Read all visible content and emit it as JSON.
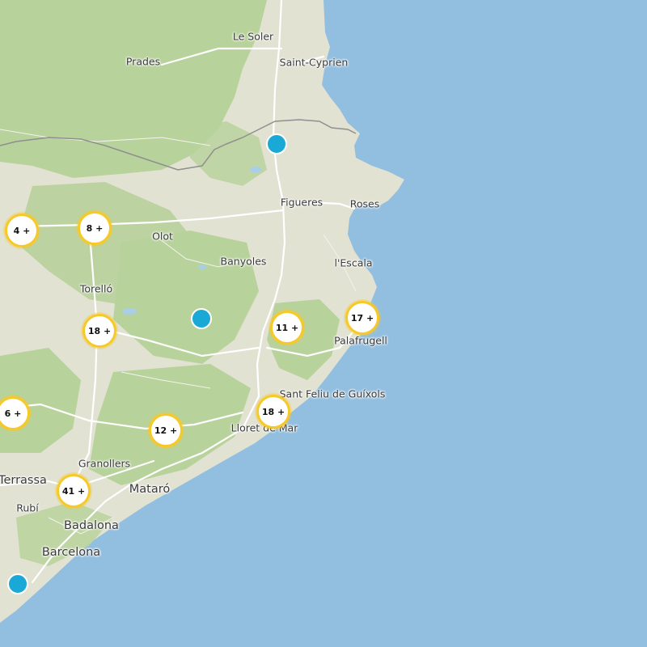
{
  "map": {
    "colors": {
      "sea": "#92bfe0",
      "land": "#e1e2d2",
      "forest": "#b8d29b",
      "road": "#ffffff",
      "border": "#8f8f8f",
      "cluster_ring": "#f7c928",
      "marker": "#1aa9d6"
    },
    "places": [
      {
        "id": "le-soler",
        "label": "Le Soler",
        "size": "town"
      },
      {
        "id": "prades",
        "label": "Prades",
        "size": "town"
      },
      {
        "id": "saint-cyprien",
        "label": "Saint-Cyprien",
        "size": "town"
      },
      {
        "id": "figueres",
        "label": "Figueres",
        "size": "town"
      },
      {
        "id": "roses",
        "label": "Roses",
        "size": "town"
      },
      {
        "id": "olot",
        "label": "Olot",
        "size": "town"
      },
      {
        "id": "banyoles",
        "label": "Banyoles",
        "size": "town"
      },
      {
        "id": "lescala",
        "label": "l'Escala",
        "size": "town"
      },
      {
        "id": "torello",
        "label": "Torelló",
        "size": "town"
      },
      {
        "id": "palafrugell",
        "label": "Palafrugell",
        "size": "town"
      },
      {
        "id": "sant-feliu",
        "label": "Sant Feliu de Guíxols",
        "size": "town"
      },
      {
        "id": "lloret",
        "label": "Lloret de Mar",
        "size": "town"
      },
      {
        "id": "granollers",
        "label": "Granollers",
        "size": "town"
      },
      {
        "id": "terrassa",
        "label": "Terrassa",
        "size": "city"
      },
      {
        "id": "mataro",
        "label": "Mataró",
        "size": "city"
      },
      {
        "id": "rubi",
        "label": "Rubí",
        "size": "town"
      },
      {
        "id": "badalona",
        "label": "Badalona",
        "size": "city"
      },
      {
        "id": "barcelona",
        "label": "Barcelona",
        "size": "city"
      }
    ],
    "clusters": [
      {
        "id": "c1",
        "label": "4 +"
      },
      {
        "id": "c2",
        "label": "8 +"
      },
      {
        "id": "c3",
        "label": "18 +"
      },
      {
        "id": "c4",
        "label": "11 +"
      },
      {
        "id": "c5",
        "label": "17 +"
      },
      {
        "id": "c6",
        "label": "6 +"
      },
      {
        "id": "c7",
        "label": "18 +"
      },
      {
        "id": "c8",
        "label": "12 +"
      },
      {
        "id": "c9",
        "label": "41 +"
      }
    ],
    "markers": [
      {
        "id": "m1"
      },
      {
        "id": "m2"
      },
      {
        "id": "m3"
      }
    ]
  }
}
